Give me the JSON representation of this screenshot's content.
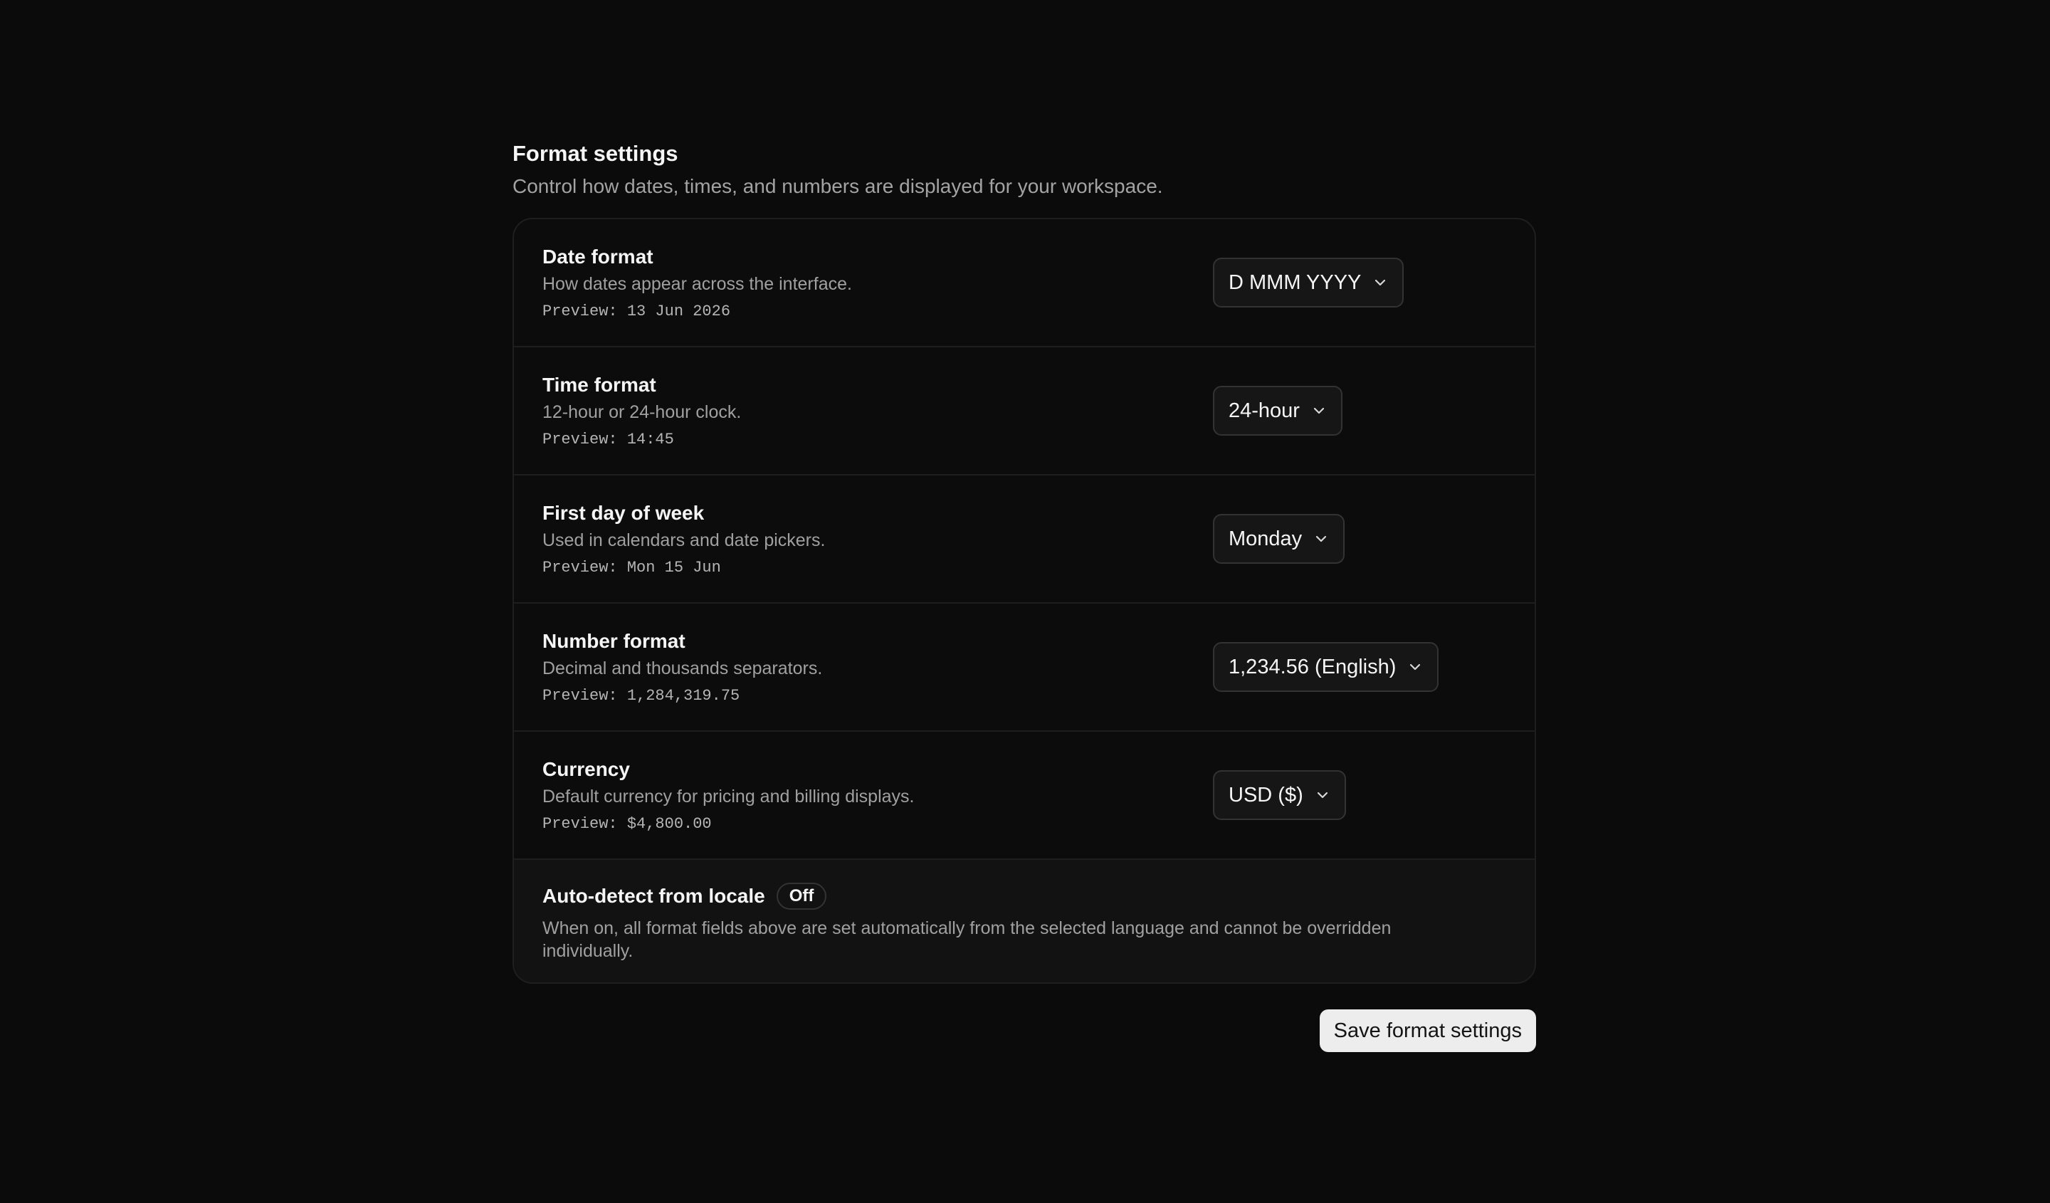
{
  "header": {
    "title": "Format settings",
    "subtitle": "Control how dates, times, and numbers are displayed for your workspace."
  },
  "settings": [
    {
      "label": "Date format",
      "description": "How dates appear across the interface.",
      "preview": "Preview: 13 Jun 2026",
      "value": "D MMM YYYY",
      "icon": "chevron-down-icon"
    },
    {
      "label": "Time format",
      "description": "12-hour or 24-hour clock.",
      "preview": "Preview: 14:45",
      "value": "24-hour",
      "icon": "chevron-down-icon"
    },
    {
      "label": "First day of week",
      "description": "Used in calendars and date pickers.",
      "preview": "Preview: Mon 15 Jun",
      "value": "Monday",
      "icon": "chevron-down-icon"
    },
    {
      "label": "Number format",
      "description": "Decimal and thousands separators.",
      "preview": "Preview: 1,284,319.75",
      "value": "1,234.56 (English)",
      "icon": "chevron-down-icon"
    },
    {
      "label": "Currency",
      "description": "Default currency for pricing and billing displays.",
      "preview": "Preview: $4,800.00",
      "value": "USD ($)",
      "icon": "chevron-down-icon"
    }
  ],
  "auto_detect": {
    "label": "Auto-detect from locale",
    "status": "Off",
    "description": "When on, all format fields above are set automatically from the selected language and cannot be overridden individually."
  },
  "actions": {
    "save_label": "Save format settings"
  },
  "colors": {
    "background": "#0b0b0b",
    "button_bg": "#ededed",
    "muted_text": "#a0a0a0"
  }
}
